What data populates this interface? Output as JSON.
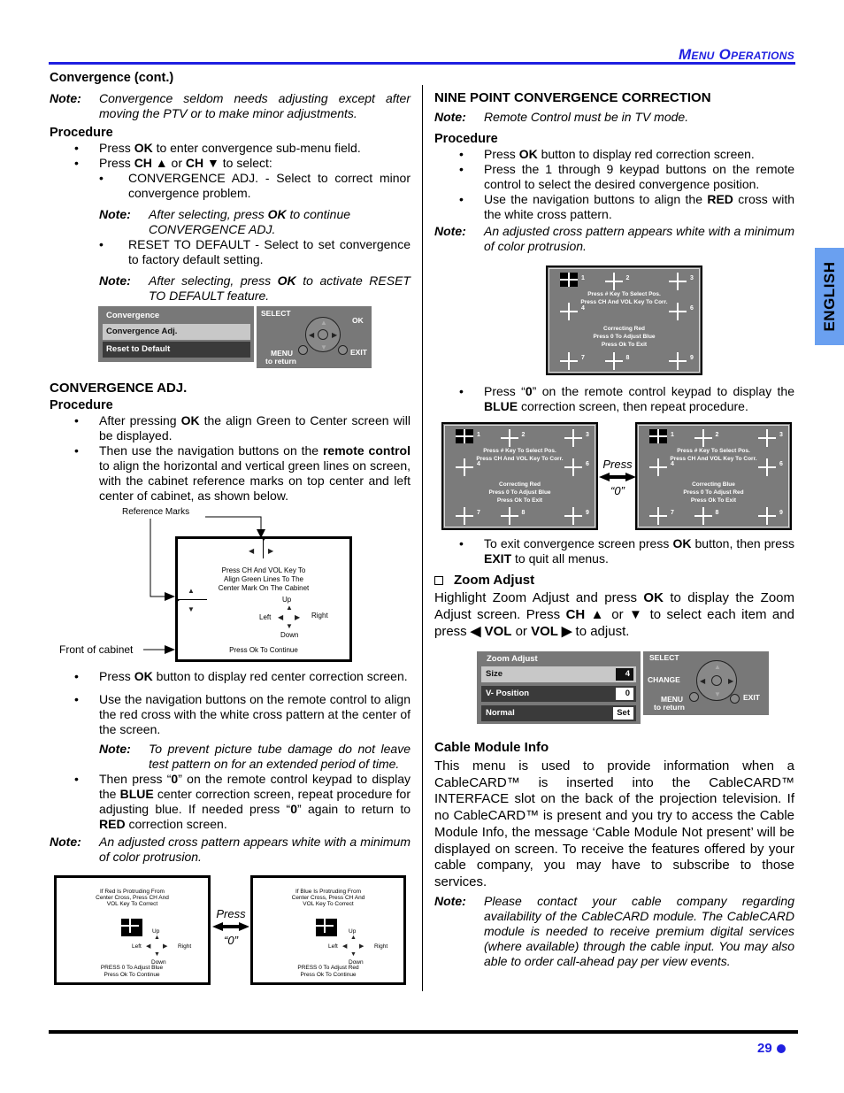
{
  "header": {
    "section_title": "Menu Operations"
  },
  "side_tab": {
    "label": "ENGLISH"
  },
  "footer": {
    "page_number": "29"
  },
  "colors": {
    "accent": "#1f1fe0",
    "tab": "#6aa0f0",
    "osd_gray": "#787878"
  },
  "left": {
    "title": "Convergence (cont.)",
    "note1": {
      "label": "Note:",
      "text": "Convergence seldom needs adjusting except after moving the PTV or to make minor adjustments."
    },
    "procedure_heading": "Procedure",
    "bullets": [
      {
        "pre": "Press ",
        "bold": "OK",
        "post": " to enter convergence  sub-menu field."
      },
      {
        "pre": "Press ",
        "bold": "CH ▲",
        "mid": " or ",
        "bold2": "CH ▼",
        "post": "   to select:"
      }
    ],
    "sub_bullets": [
      "CONVERGENCE ADJ. - Select to correct minor convergence problem.",
      "RESET TO DEFAULT - Select to set convergence to factory default setting."
    ],
    "note2": {
      "label": "Note:",
      "pre": "After selecting,  press ",
      "bold": "OK",
      "post": "  to  continue CONVERGENCE ADJ."
    },
    "note3": {
      "label": "Note:",
      "pre": "After selecting, press ",
      "bold": "OK",
      "post": " to activate RESET TO DEFAULT feature."
    },
    "convergence_menu": {
      "title": "Convergence",
      "items": [
        "Convergence  Adj.",
        "Reset to Default"
      ]
    },
    "remote_legend": {
      "select": "SELECT",
      "ok": "OK",
      "menu": "MENU",
      "to_return": "to return",
      "exit": "EXIT"
    },
    "conv_adj_heading": "CONVERGENCE ADJ.",
    "conv_adj_procedure": "Procedure",
    "conv_bullets": [
      {
        "pre": "After pressing ",
        "bold": "OK",
        "post": "  the align Green to Center screen will be displayed."
      },
      {
        "pre": "Then use the navigation buttons on the ",
        "bold": "remote control",
        "post": " to align the horizontal and vertical green lines on screen, with the cabinet reference marks on top center and left center of cabinet, as shown below."
      }
    ],
    "cabinet_diagram": {
      "reference_marks": "Reference Marks",
      "front_of_cabinet": "Front of cabinet",
      "instructions": [
        "Press CH And VOL Key To",
        "Align Green Lines To The",
        "Center Mark On The Cabinet"
      ],
      "up": "Up",
      "down": "Down",
      "left": "Left",
      "right": "Right",
      "continue": "Press Ok To Continue"
    },
    "bullets2": [
      {
        "pre": "Press ",
        "bold": "OK",
        "post": " button to display red center correction screen."
      },
      {
        "pre": "Use the navigation buttons on the remote control to align the red cross with the white cross pattern at the center of the screen.",
        "bold": "",
        "post": ""
      }
    ],
    "note4": {
      "label": "Note:",
      "text": "To prevent picture tube damage do not leave test pattern on for an extended period of time."
    },
    "bullet3": {
      "p1": "Then press “",
      "b1": "0",
      "p2": "” on the remote control keypad to display the ",
      "b2": "BLUE",
      "p3": " center correction screen, repeat procedure for adjusting blue. If needed press “",
      "b3": "0",
      "p4": "” again to return to ",
      "b4": "RED",
      "p5": " correction screen."
    },
    "note5": {
      "label": "Note:",
      "text": "An adjusted cross pattern appears white with a minimum of color protrusion."
    },
    "center_screens": [
      {
        "lines": [
          "If Red Is Protruding From",
          "Center Cross, Press CH And",
          "VOL Key To Correct"
        ],
        "footer": [
          "PRESS 0 To Adjust Blue",
          "Press Ok To Continue"
        ]
      },
      {
        "lines": [
          "If Blue Is Protruding From",
          "Center Cross, Press CH And",
          "VOL Key To Correct"
        ],
        "footer": [
          "PRESS 0 To Adjust Red",
          "Press Ok To Continue"
        ]
      }
    ],
    "dir": {
      "up": "Up",
      "down": "Down",
      "left": "Left",
      "right": "Right"
    },
    "press_label": "Press",
    "press_key": "“0”"
  },
  "right": {
    "title": "NINE POINT CONVERGENCE CORRECTION",
    "note1": {
      "label": "Note:",
      "text": "Remote Control must be in TV mode."
    },
    "procedure_heading": "Procedure",
    "bullets": [
      {
        "pre": "Press ",
        "bold": "OK",
        "post": " button to display red correction screen."
      },
      {
        "pre": "Press the 1 through 9 keypad buttons on the remote control to select the desired convergence position.",
        "bold": "",
        "post": ""
      },
      {
        "pre": "Use the navigation buttons to align the ",
        "bold": "RED",
        "post": " cross with the white cross pattern."
      }
    ],
    "note2": {
      "label": "Note:",
      "text": "An adjusted cross pattern appears white with a minimum of color protrusion."
    },
    "grid_screens": [
      {
        "top": [
          "Press # Key To Select Pos.",
          "Press CH And VOL Key To Corr."
        ],
        "bottom": [
          "Correcting Red",
          "Press 0 To Adjust Blue",
          "Press Ok To Exit"
        ]
      },
      {
        "top": [
          "Press # Key To Select Pos.",
          "Press CH And VOL Key To Corr."
        ],
        "bottom": [
          "Correcting Red",
          "Press 0 To Adjust Blue",
          "Press Ok To Exit"
        ]
      },
      {
        "top": [
          "Press # Key To Select Pos.",
          "Press CH And VOL Key To Corr."
        ],
        "bottom": [
          "Correcting Blue",
          "Press 0 To Adjust Red",
          "Press Ok To Exit"
        ]
      }
    ],
    "positions": [
      "1",
      "2",
      "3",
      "4",
      "6",
      "7",
      "8",
      "9"
    ],
    "bullet_blue": {
      "p1": "Press “",
      "b1": "0",
      "p2": "” on the remote control keypad to display the ",
      "b2": "BLUE",
      "p3": " correction screen, then repeat procedure."
    },
    "bullet_exit": {
      "p1": "To exit convergence screen press ",
      "b1": "OK",
      "p2": " button, then press ",
      "b2": "EXIT",
      "p3": " to quit all menus."
    },
    "press_label": "Press",
    "press_key": "“0”",
    "zoom": {
      "heading": "Zoom Adjust",
      "text": {
        "p1": "Highlight Zoom Adjust and press ",
        "b1": "OK",
        "p2": " to display the Zoom Adjust screen. Press ",
        "b2": "CH ▲",
        "p3": " or ",
        "b3": "▼",
        "p4": " to select each item and press ",
        "b4": "◀  VOL",
        "p5": " or ",
        "b5": "VOL ▶",
        "p6": " to adjust."
      },
      "menu": {
        "title": "Zoom Adjust",
        "rows": [
          {
            "label": "Size",
            "value": "4"
          },
          {
            "label": "V- Position",
            "value": "0"
          },
          {
            "label": "Normal",
            "value": "Set"
          }
        ]
      },
      "remote": {
        "select": "SELECT",
        "change": "CHANGE",
        "menu": "MENU",
        "to_return": "to return",
        "exit": "EXIT"
      }
    },
    "cable": {
      "heading": "Cable Module Info",
      "text": "This menu is used to provide information when a CableCARD™ is inserted into the CableCARD™ INTERFACE slot on the back of the projection television. If no CableCARD™ is present and you try to access the Cable Module Info, the message ‘Cable Module Not present’ will be displayed on screen. To receive the features offered by your cable company, you may have to subscribe to those services.",
      "note": {
        "label": "Note:",
        "text": "Please contact your cable company regarding availability of the CableCARD module. The CableCARD module is needed to receive premium digital services (where available)  through the cable input. You may also able to order call-ahead pay per view events."
      }
    }
  }
}
